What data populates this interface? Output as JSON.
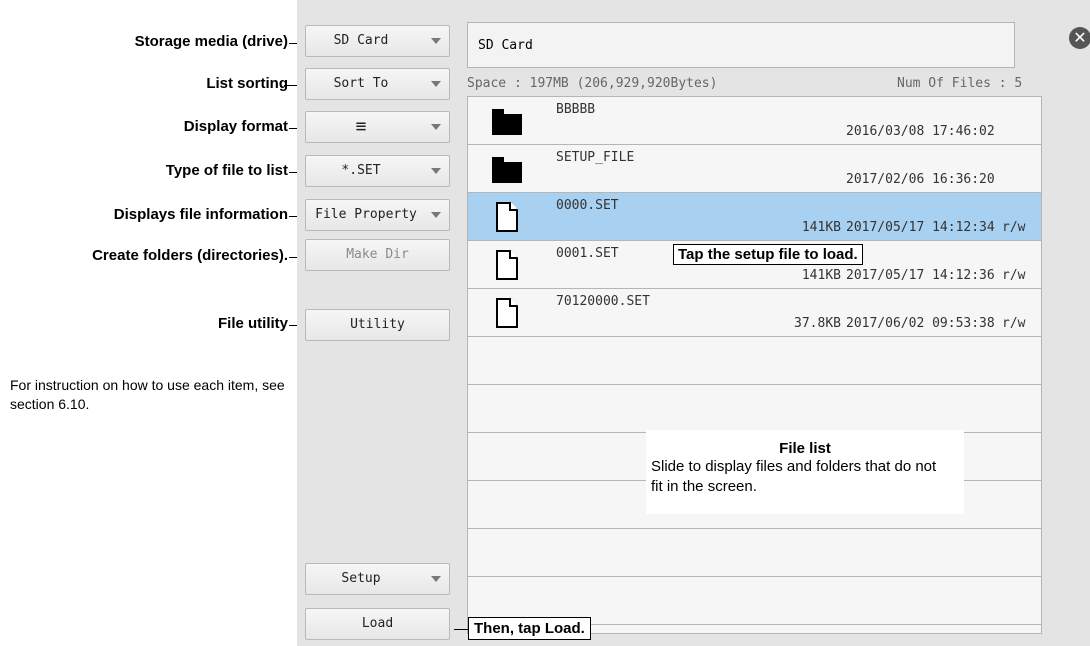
{
  "callouts": {
    "storage": "Storage media (drive)",
    "sorting": "List sorting",
    "display_format": "Display format",
    "file_type": "Type of file to list",
    "file_info": "Displays file information",
    "create_folders": "Create folders (directories).",
    "file_utility": "File utility",
    "note": "For instruction on how to use each item, see section 6.10.",
    "tap_setup": "Tap the setup file to load.",
    "then_load": "Then, tap Load.",
    "file_list_title": "File list",
    "file_list_desc": "Slide to display files and folders that do not fit in the screen."
  },
  "buttons": {
    "drive": "SD Card",
    "sort": "Sort To",
    "display_format": "≡",
    "file_type": "*.SET",
    "file_property": "File Property",
    "make_dir": "Make Dir",
    "utility": "Utility",
    "setup": "Setup",
    "load": "Load"
  },
  "drive_path": "SD Card",
  "space": "Space : 197MB (206,929,920Bytes)",
  "num_files": "Num Of Files : 5",
  "close_icon": "close-icon",
  "files": [
    {
      "name": "BBBBB",
      "size": "",
      "date": "2016/03/08 17:46:02",
      "perm": "",
      "icon": "folder-icon",
      "selected": false
    },
    {
      "name": "SETUP_FILE",
      "size": "",
      "date": "2017/02/06 16:36:20",
      "perm": "",
      "icon": "folder-icon",
      "selected": false
    },
    {
      "name": "0000.SET",
      "size": "141KB",
      "date": "2017/05/17 14:12:34",
      "perm": "r/w",
      "icon": "file-icon",
      "selected": true
    },
    {
      "name": "0001.SET",
      "size": "141KB",
      "date": "2017/05/17 14:12:36",
      "perm": "r/w",
      "icon": "file-icon",
      "selected": false
    },
    {
      "name": "70120000.SET",
      "size": "37.8KB",
      "date": "2017/06/02 09:53:38",
      "perm": "r/w",
      "icon": "file-icon",
      "selected": false
    }
  ],
  "colors": {
    "selected_row": "#a8d0f0",
    "panel_bg": "#e4e4e4"
  }
}
